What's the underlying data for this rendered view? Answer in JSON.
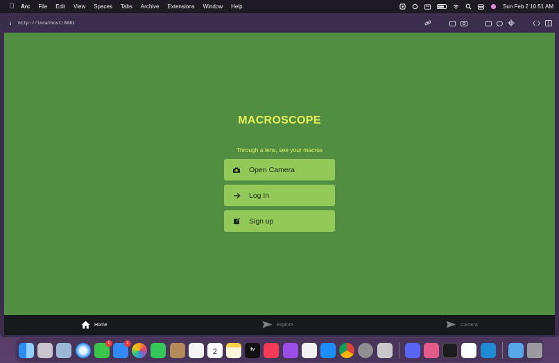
{
  "menubar": {
    "app_name": "Arc",
    "menus": [
      "File",
      "Edit",
      "View",
      "Spaces",
      "Tabs",
      "Archive",
      "Extensions",
      "Window",
      "Help"
    ],
    "clock": "Sun Feb 2  10:51 AM"
  },
  "browser": {
    "url": "http://localhost:8081",
    "info_glyph": "i"
  },
  "app": {
    "title": "MACROSCOPE",
    "subtitle": "Through a lens, see your macros",
    "buttons": [
      {
        "label": "Open Camera",
        "icon": "camera-icon"
      },
      {
        "label": "Log In",
        "icon": "arrow-right-icon"
      },
      {
        "label": "Sign up",
        "icon": "edit-icon"
      }
    ],
    "accent_color": "#e4f15a",
    "background_color": "#528e41",
    "button_color": "#93c959"
  },
  "tabbar": {
    "tabs": [
      {
        "label": "Home",
        "icon": "home-icon",
        "active": true
      },
      {
        "label": "Explore",
        "icon": "send-icon",
        "active": false
      },
      {
        "label": "Camera",
        "icon": "send-icon",
        "active": false
      }
    ]
  },
  "dock": {
    "mail_badge": "1",
    "messages_badge": "1",
    "calendar_day": "2",
    "tv_label": "tv"
  }
}
